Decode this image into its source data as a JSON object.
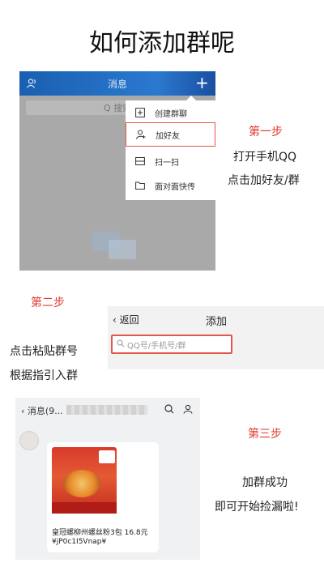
{
  "title": "如何添加群呢",
  "panel1": {
    "header_title": "消息",
    "search_placeholder": "Q 搜索",
    "menu": [
      {
        "label": "创建群聊",
        "icon": "plus-square-icon"
      },
      {
        "label": "加好友",
        "icon": "add-user-icon"
      },
      {
        "label": "扫一扫",
        "icon": "scan-icon"
      },
      {
        "label": "面对面快传",
        "icon": "folder-icon"
      }
    ]
  },
  "step1": {
    "label": "第一步",
    "line1": "打开手机QQ",
    "line2": "点击加好友/群"
  },
  "step2": {
    "label": "第二步",
    "line1": "点击粘贴群号",
    "line2": "根据指引入群"
  },
  "panel2": {
    "back": "返回",
    "title": "添加",
    "search_placeholder": "QQ号/手机号/群"
  },
  "step3": {
    "label": "第三步",
    "line1": "加群成功",
    "line2": "即可开始捡漏啦!"
  },
  "panel3": {
    "back": "消息(9...",
    "product_line1": "皇冠螺柳州螺丝粉3包  16.8元",
    "product_line2": "¥jP0c1I5Vnap¥"
  },
  "colors": {
    "accent_red": "#e03a2e",
    "qq_blue": "#1a5fb0"
  }
}
